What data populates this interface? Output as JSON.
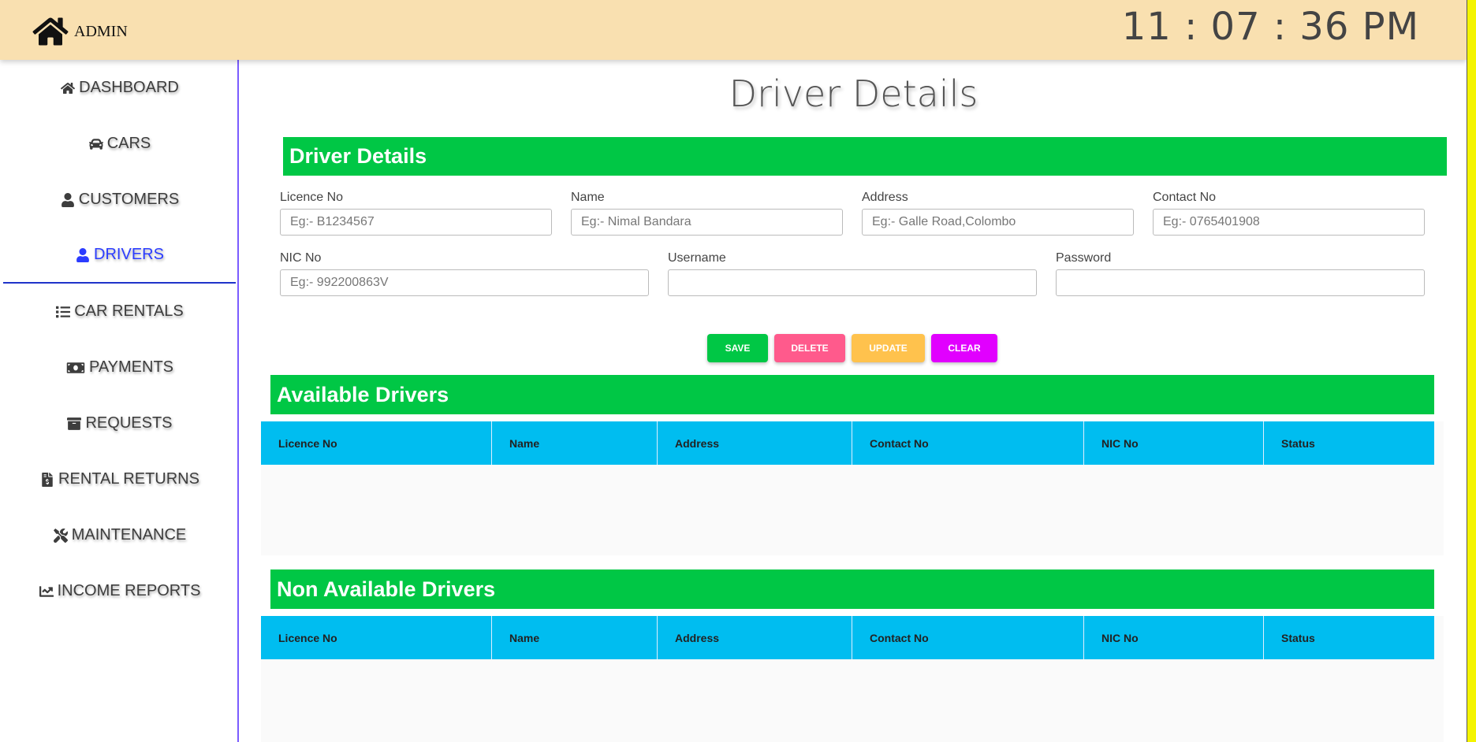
{
  "header": {
    "brand": "ADMIN",
    "clock": "11 : 07 : 36 PM"
  },
  "sidebar": {
    "items": [
      {
        "label": "DASHBOARD",
        "icon": "home-icon"
      },
      {
        "label": "CARS",
        "icon": "car-icon"
      },
      {
        "label": "CUSTOMERS",
        "icon": "user-icon"
      },
      {
        "label": "DRIVERS",
        "icon": "user-icon",
        "active": true
      },
      {
        "label": "CAR RENTALS",
        "icon": "list-icon"
      },
      {
        "label": "PAYMENTS",
        "icon": "money-icon"
      },
      {
        "label": "REQUESTS",
        "icon": "archive-icon"
      },
      {
        "label": "RENTAL RETURNS",
        "icon": "invoice-icon"
      },
      {
        "label": "MAINTENANCE",
        "icon": "tools-icon"
      },
      {
        "label": "INCOME REPORTS",
        "icon": "chart-line-icon"
      }
    ]
  },
  "page": {
    "title": "Driver Details"
  },
  "form": {
    "section_title": "Driver Details",
    "fields": {
      "licence": {
        "label": "Licence No",
        "placeholder": "Eg:- B1234567",
        "value": ""
      },
      "name": {
        "label": "Name",
        "placeholder": "Eg:- Nimal Bandara",
        "value": ""
      },
      "address": {
        "label": "Address",
        "placeholder": "Eg:- Galle Road,Colombo",
        "value": ""
      },
      "contact": {
        "label": "Contact No",
        "placeholder": "Eg:- 0765401908",
        "value": ""
      },
      "nic": {
        "label": "NIC No",
        "placeholder": "Eg:- 992200863V",
        "value": ""
      },
      "username": {
        "label": "Username",
        "placeholder": "",
        "value": ""
      },
      "password": {
        "label": "Password",
        "placeholder": "",
        "value": ""
      }
    },
    "buttons": {
      "save": "SAVE",
      "delete": "DELETE",
      "update": "UPDATE",
      "clear": "CLEAR"
    }
  },
  "available": {
    "title": "Available Drivers",
    "columns": [
      "Licence No",
      "Name",
      "Address",
      "Contact No",
      "NIC No",
      "Status"
    ],
    "rows": []
  },
  "non_available": {
    "title": "Non Available Drivers",
    "columns": [
      "Licence No",
      "Name",
      "Address",
      "Contact No",
      "NIC No",
      "Status"
    ],
    "rows": []
  },
  "colors": {
    "header_bg": "#f9e0b0",
    "section_green": "#00c745",
    "table_header": "#00bdf0",
    "save": "#00c745",
    "delete": "#ff5a8c",
    "update": "#ffc24d",
    "clear": "#e100ff",
    "active_nav": "#2b3cff"
  }
}
